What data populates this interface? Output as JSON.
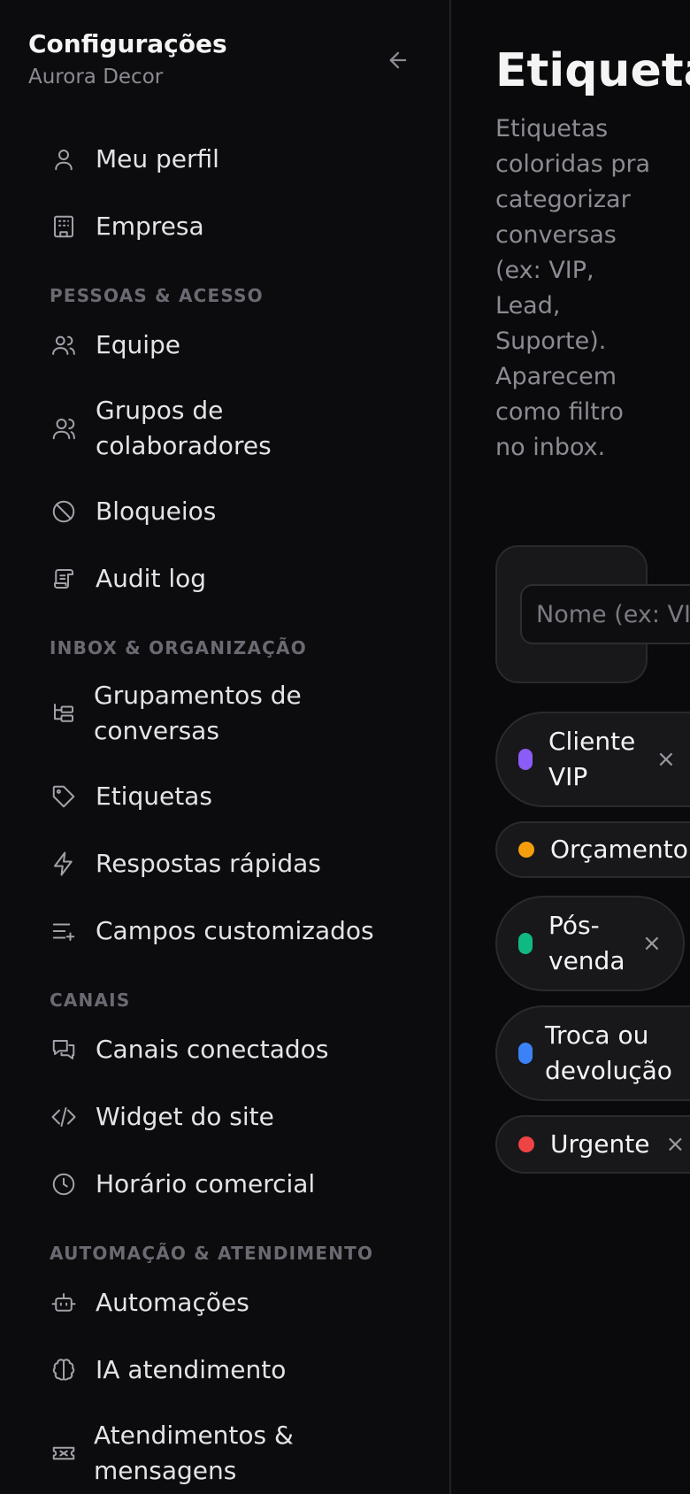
{
  "sidebar": {
    "title": "Configurações",
    "subtitle": "Aurora Decor",
    "items_top": [
      {
        "label": "Meu perfil",
        "icon": "user-icon"
      },
      {
        "label": "Empresa",
        "icon": "building-icon"
      }
    ],
    "sections": [
      {
        "heading": "PESSOAS & ACESSO",
        "items": [
          {
            "label": "Equipe",
            "icon": "users-icon"
          },
          {
            "label": "Grupos de colaboradores",
            "icon": "users-group-icon"
          },
          {
            "label": "Bloqueios",
            "icon": "ban-icon"
          },
          {
            "label": "Audit log",
            "icon": "scroll-icon"
          }
        ]
      },
      {
        "heading": "INBOX & ORGANIZAÇÃO",
        "items": [
          {
            "label": "Grupamentos de conversas",
            "icon": "folder-tree-icon"
          },
          {
            "label": "Etiquetas",
            "icon": "tag-icon"
          },
          {
            "label": "Respostas rápidas",
            "icon": "zap-icon"
          },
          {
            "label": "Campos customizados",
            "icon": "list-plus-icon"
          }
        ]
      },
      {
        "heading": "CANAIS",
        "items": [
          {
            "label": "Canais conectados",
            "icon": "messages-icon"
          },
          {
            "label": "Widget do site",
            "icon": "code-icon"
          },
          {
            "label": "Horário comercial",
            "icon": "clock-icon"
          }
        ]
      },
      {
        "heading": "AUTOMAÇÃO & ATENDIMENTO",
        "items": [
          {
            "label": "Automações",
            "icon": "bot-icon"
          },
          {
            "label": "IA atendimento",
            "icon": "brain-icon"
          },
          {
            "label": "Atendimentos & mensagens",
            "icon": "ticket-icon"
          }
        ]
      }
    ]
  },
  "main": {
    "title": "Etiquetas",
    "description": "Etiquetas coloridas pra categorizar conversas (ex: VIP, Lead, Suporte). Aparecem como filtro no inbox.",
    "name_placeholder": "Nome (ex: VIP)",
    "remove_symbol": "×",
    "tags": [
      {
        "label": "Cliente VIP",
        "color": "#8b5cf6"
      },
      {
        "label": "Orçamento",
        "color": "#f59e0b"
      },
      {
        "label": "Pós-venda",
        "color": "#10b981"
      },
      {
        "label": "Troca ou devolução",
        "color": "#3b82f6"
      },
      {
        "label": "Urgente",
        "color": "#ef4444"
      }
    ]
  }
}
